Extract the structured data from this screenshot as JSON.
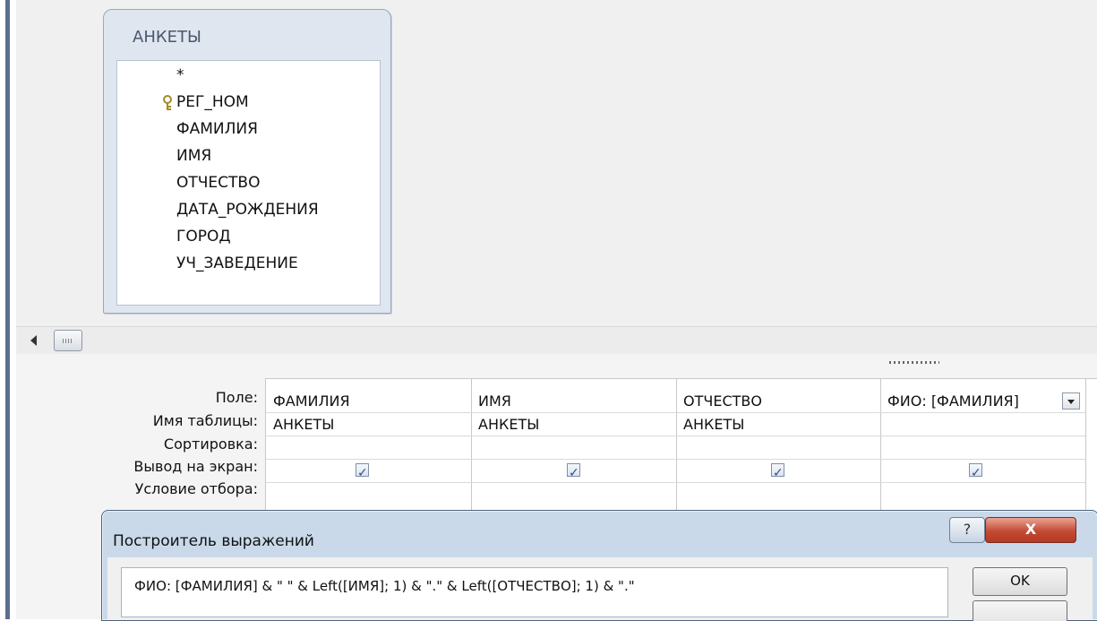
{
  "table": {
    "title": "АНКЕТЫ",
    "fields": [
      "*",
      "РЕГ_НОМ",
      "ФАМИЛИЯ",
      "ИМЯ",
      "ОТЧЕСТВО",
      "ДАТА_РОЖДЕНИЯ",
      "ГОРОД",
      "УЧ_ЗАВЕДЕНИЕ"
    ]
  },
  "grid": {
    "row_labels": [
      "Поле:",
      "Имя таблицы:",
      "Сортировка:",
      "Вывод на экран:",
      "Условие отбора:"
    ],
    "columns": [
      {
        "field": "ФАМИЛИЯ",
        "table": "АНКЕТЫ",
        "show": true
      },
      {
        "field": "ИМЯ",
        "table": "АНКЕТЫ",
        "show": true
      },
      {
        "field": "ОТЧЕСТВО",
        "table": "АНКЕТЫ",
        "show": true
      },
      {
        "field": "ФИО: [ФАМИЛИЯ]",
        "table": "",
        "show": true
      }
    ]
  },
  "dialog": {
    "title": "Построитель выражений",
    "help_label": "?",
    "close_label": "X",
    "expression": "ФИО: [ФАМИЛИЯ] & \" \" & Left([ИМЯ]; 1) & \".\" & Left([ОТЧЕСТВО]; 1) & \".\"",
    "ok_label": "OK"
  }
}
